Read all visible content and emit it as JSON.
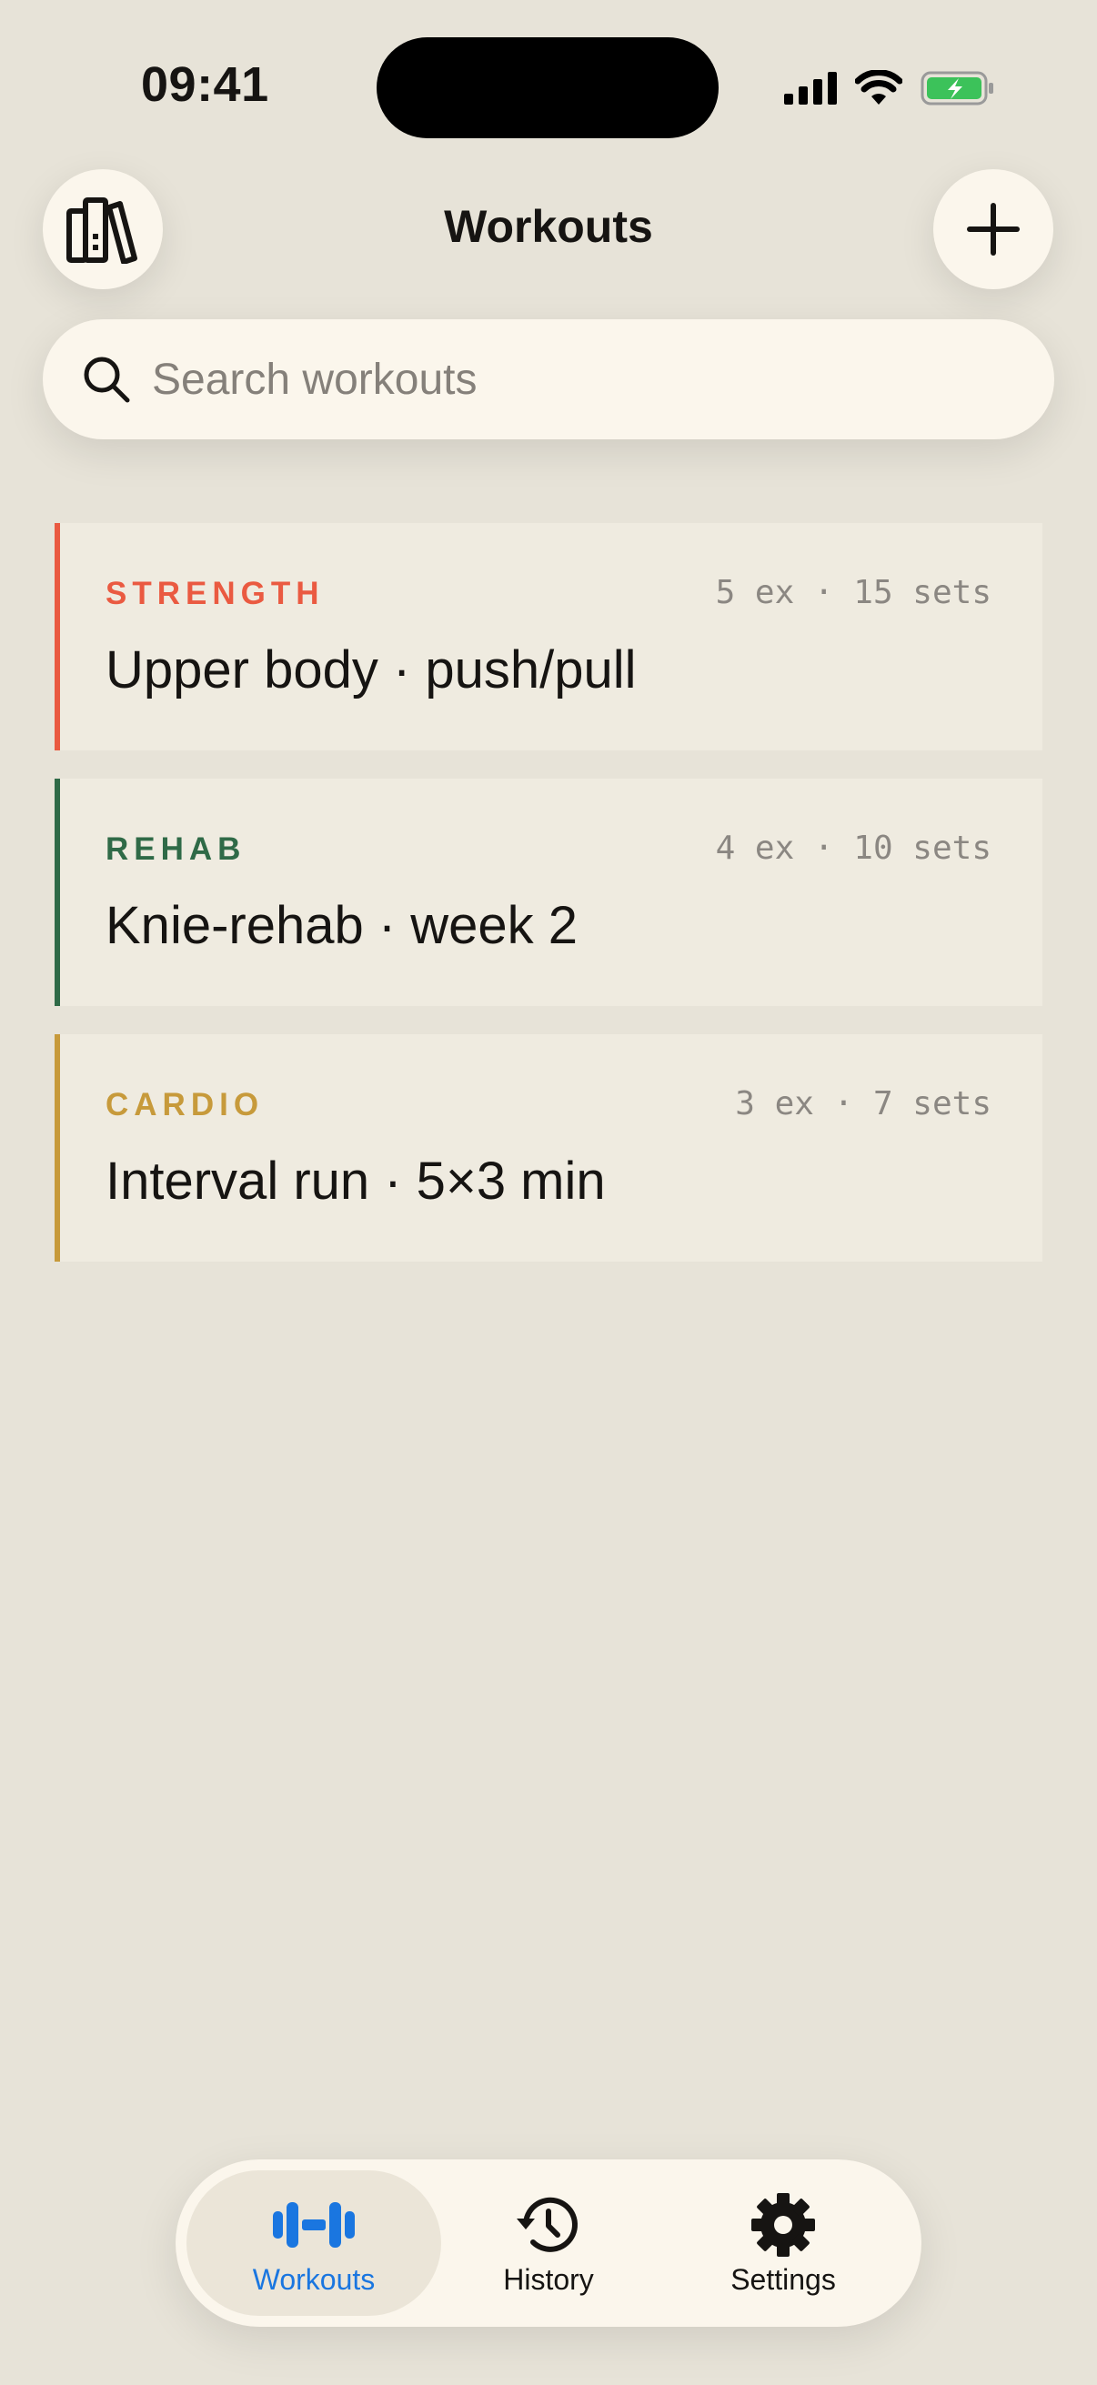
{
  "status_bar": {
    "time": "09:41"
  },
  "header": {
    "title": "Workouts"
  },
  "search": {
    "placeholder": "Search workouts",
    "value": ""
  },
  "workouts": [
    {
      "category": "STRENGTH",
      "meta": "5 ex · 15 sets",
      "title": "Upper body · push/pull",
      "color": "#ea5a41"
    },
    {
      "category": "REHAB",
      "meta": "4 ex · 10 sets",
      "title": "Knie-rehab · week 2",
      "color": "#2f6a47"
    },
    {
      "category": "CARDIO",
      "meta": "3 ex · 7 sets",
      "title": "Interval run · 5×3 min",
      "color": "#c79a3b"
    }
  ],
  "tabbar": {
    "items": [
      {
        "label": "Workouts",
        "icon": "dumbbell-icon",
        "active": true
      },
      {
        "label": "History",
        "icon": "history-icon",
        "active": false
      },
      {
        "label": "Settings",
        "icon": "gear-icon",
        "active": false
      }
    ]
  },
  "colors": {
    "accent": "#1a76e0",
    "background": "#e7e3d8",
    "surface": "#fbf6ec",
    "card": "#efebe0"
  }
}
